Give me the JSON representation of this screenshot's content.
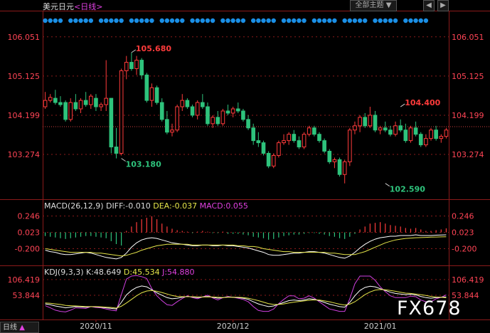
{
  "header": {
    "symbol": "美元日元",
    "period": "<日线>",
    "theme_label": "全部主题",
    "theme_arrow": "▼",
    "prev_arrow": "◀",
    "next_arrow": "▶"
  },
  "indicators": {
    "macd": {
      "name": "MACD(26,12,9)",
      "diff": "DIFF:-0.010",
      "dea": "DEA:-0.037",
      "macd": "MACD:0.055"
    },
    "kdj": {
      "name": "KDJ(9,3,3)",
      "k": "K:48.649",
      "d": "D:45.534",
      "j": "J:54.880"
    }
  },
  "status": {
    "label": "日线",
    "arrow": "▲"
  },
  "watermark": "FX678",
  "colors": {
    "up": "#ff3b3b",
    "down": "#2ec37c",
    "grid": "#8b1a1a",
    "axis_label": "#ff4455",
    "dot": "#1a8fe6",
    "yellow": "#e6e64a",
    "white": "#ffffff",
    "magenta": "#d040e0"
  },
  "chart_data": [
    {
      "type": "candlestick",
      "title": "美元日元 <日线>",
      "y_ticks": [
        "106.051",
        "105.125",
        "104.199",
        "103.274"
      ],
      "y_tick_values": [
        106.051,
        105.125,
        104.199,
        103.274
      ],
      "ylim": [
        102.35,
        106.35
      ],
      "x_ticks": [
        "2020/11",
        "2020/12",
        "2021/01"
      ],
      "x_tick_index": [
        10,
        37,
        66
      ],
      "current_price_line": 103.93,
      "annotations": [
        {
          "text": "105.680",
          "index": 17,
          "value": 105.68,
          "kind": "high"
        },
        {
          "text": "103.180",
          "index": 15,
          "value": 103.18,
          "kind": "low"
        },
        {
          "text": "104.400",
          "index": 70,
          "value": 104.4,
          "kind": "high"
        },
        {
          "text": "102.590",
          "index": 67,
          "value": 102.59,
          "kind": "low"
        }
      ],
      "ohlc": [
        [
          104.4,
          104.75,
          104.35,
          104.55
        ],
        [
          104.55,
          104.7,
          104.5,
          104.62
        ],
        [
          104.6,
          104.8,
          104.45,
          104.5
        ],
        [
          104.5,
          104.65,
          104.4,
          104.45
        ],
        [
          104.5,
          104.55,
          104.05,
          104.1
        ],
        [
          104.1,
          104.6,
          104.05,
          104.5
        ],
        [
          104.5,
          104.7,
          104.3,
          104.35
        ],
        [
          104.35,
          104.6,
          104.25,
          104.55
        ],
        [
          104.55,
          104.75,
          104.4,
          104.45
        ],
        [
          104.45,
          104.7,
          104.35,
          104.65
        ],
        [
          104.6,
          104.7,
          104.3,
          104.4
        ],
        [
          104.4,
          104.5,
          104.3,
          104.45
        ],
        [
          104.45,
          105.5,
          104.3,
          104.6
        ],
        [
          104.6,
          104.6,
          103.3,
          103.45
        ],
        [
          103.45,
          103.9,
          103.18,
          103.3
        ],
        [
          103.3,
          105.3,
          103.25,
          105.25
        ],
        [
          105.25,
          105.6,
          105.05,
          105.45
        ],
        [
          105.45,
          105.68,
          105.25,
          105.3
        ],
        [
          105.3,
          105.6,
          105.15,
          105.5
        ],
        [
          105.5,
          105.55,
          105.05,
          105.15
        ],
        [
          105.15,
          105.2,
          104.5,
          104.55
        ],
        [
          104.55,
          104.95,
          104.4,
          104.85
        ],
        [
          104.85,
          104.9,
          104.45,
          104.5
        ],
        [
          104.5,
          104.6,
          104.05,
          104.1
        ],
        [
          104.1,
          104.3,
          103.75,
          103.8
        ],
        [
          103.8,
          104.0,
          103.7,
          103.85
        ],
        [
          103.85,
          104.45,
          103.8,
          104.4
        ],
        [
          104.4,
          104.7,
          104.3,
          104.55
        ],
        [
          104.55,
          104.6,
          104.35,
          104.4
        ],
        [
          104.4,
          104.45,
          104.15,
          104.2
        ],
        [
          104.2,
          104.55,
          104.1,
          104.5
        ],
        [
          104.5,
          104.7,
          104.35,
          104.4
        ],
        [
          104.4,
          104.5,
          103.95,
          104.0
        ],
        [
          104.0,
          104.2,
          103.9,
          104.15
        ],
        [
          104.15,
          104.3,
          103.95,
          104.0
        ],
        [
          104.0,
          104.35,
          103.95,
          104.3
        ],
        [
          104.3,
          104.45,
          104.2,
          104.25
        ],
        [
          104.25,
          104.4,
          104.15,
          104.35
        ],
        [
          104.35,
          104.5,
          104.25,
          104.3
        ],
        [
          104.3,
          104.35,
          104.05,
          104.1
        ],
        [
          104.1,
          104.2,
          103.85,
          103.9
        ],
        [
          103.9,
          104.0,
          103.5,
          103.6
        ],
        [
          103.6,
          103.8,
          103.45,
          103.55
        ],
        [
          103.55,
          103.6,
          103.25,
          103.3
        ],
        [
          103.3,
          103.35,
          102.95,
          103.0
        ],
        [
          103.0,
          103.3,
          102.95,
          103.25
        ],
        [
          103.25,
          103.6,
          103.2,
          103.55
        ],
        [
          103.55,
          103.75,
          103.5,
          103.6
        ],
        [
          103.6,
          103.8,
          103.5,
          103.75
        ],
        [
          103.75,
          103.85,
          103.55,
          103.6
        ],
        [
          103.6,
          103.7,
          103.4,
          103.45
        ],
        [
          103.45,
          103.8,
          103.4,
          103.75
        ],
        [
          103.75,
          103.95,
          103.7,
          103.9
        ],
        [
          103.9,
          103.95,
          103.7,
          103.75
        ],
        [
          103.75,
          103.8,
          103.55,
          103.6
        ],
        [
          103.6,
          103.65,
          103.3,
          103.35
        ],
        [
          103.35,
          103.4,
          103.05,
          103.1
        ],
        [
          103.1,
          103.2,
          102.95,
          103.15
        ],
        [
          103.15,
          103.2,
          102.75,
          102.8
        ],
        [
          102.8,
          103.15,
          102.59,
          103.1
        ],
        [
          103.1,
          103.9,
          103.0,
          103.85
        ],
        [
          103.85,
          104.05,
          103.75,
          103.95
        ],
        [
          103.95,
          104.2,
          103.8,
          104.15
        ],
        [
          104.15,
          104.25,
          103.9,
          103.95
        ],
        [
          103.95,
          104.4,
          103.9,
          104.2
        ],
        [
          104.2,
          104.3,
          103.8,
          103.85
        ],
        [
          103.85,
          103.95,
          103.75,
          103.9
        ],
        [
          103.9,
          104.05,
          103.8,
          103.85
        ],
        [
          103.85,
          103.95,
          103.7,
          103.75
        ],
        [
          103.75,
          104.05,
          103.7,
          103.95
        ],
        [
          103.95,
          104.1,
          103.8,
          103.85
        ],
        [
          103.85,
          104.0,
          103.55,
          103.6
        ],
        [
          103.6,
          103.95,
          103.55,
          103.9
        ],
        [
          103.9,
          104.05,
          103.7,
          103.75
        ],
        [
          103.75,
          103.8,
          103.45,
          103.5
        ],
        [
          103.5,
          103.75,
          103.45,
          103.65
        ],
        [
          103.65,
          103.9,
          103.6,
          103.85
        ],
        [
          103.85,
          103.95,
          103.6,
          103.65
        ],
        [
          103.65,
          103.75,
          103.55,
          103.7
        ],
        [
          103.7,
          103.9,
          103.65,
          103.85
        ]
      ]
    },
    {
      "type": "macd",
      "title": "MACD(26,12,9)",
      "y_ticks": [
        "0.246",
        "0.023",
        "-0.200"
      ],
      "y_tick_values": [
        0.246,
        0.023,
        -0.2
      ],
      "ylim": [
        -0.38,
        0.34
      ],
      "histogram": [
        -0.05,
        -0.06,
        -0.07,
        -0.08,
        -0.09,
        -0.08,
        -0.07,
        -0.06,
        -0.05,
        -0.05,
        -0.06,
        -0.07,
        -0.08,
        -0.12,
        -0.16,
        -0.18,
        0.02,
        0.08,
        0.14,
        0.18,
        0.2,
        0.22,
        0.18,
        0.12,
        0.08,
        0.05,
        0.03,
        0.02,
        0.01,
        -0.01,
        0.01,
        0.02,
        0.01,
        -0.01,
        -0.01,
        0.01,
        -0.02,
        -0.02,
        -0.02,
        -0.03,
        -0.04,
        -0.06,
        -0.07,
        -0.08,
        -0.1,
        -0.09,
        -0.07,
        -0.05,
        -0.04,
        -0.03,
        -0.03,
        -0.02,
        -0.01,
        -0.01,
        -0.02,
        -0.03,
        -0.05,
        -0.06,
        -0.08,
        -0.09,
        -0.06,
        -0.02,
        0.04,
        0.08,
        0.12,
        0.13,
        0.14,
        0.12,
        0.1,
        0.09,
        0.08,
        0.06,
        0.05,
        0.06,
        0.04,
        0.02,
        0.02,
        0.03,
        0.04,
        0.055
      ],
      "diff": [
        -0.22,
        -0.24,
        -0.25,
        -0.27,
        -0.28,
        -0.28,
        -0.27,
        -0.26,
        -0.25,
        -0.26,
        -0.28,
        -0.3,
        -0.32,
        -0.33,
        -0.34,
        -0.32,
        -0.26,
        -0.18,
        -0.12,
        -0.08,
        -0.06,
        -0.05,
        -0.06,
        -0.08,
        -0.1,
        -0.12,
        -0.13,
        -0.14,
        -0.15,
        -0.16,
        -0.16,
        -0.15,
        -0.15,
        -0.16,
        -0.16,
        -0.15,
        -0.16,
        -0.16,
        -0.17,
        -0.18,
        -0.19,
        -0.21,
        -0.23,
        -0.25,
        -0.28,
        -0.29,
        -0.29,
        -0.28,
        -0.27,
        -0.26,
        -0.26,
        -0.25,
        -0.24,
        -0.24,
        -0.25,
        -0.26,
        -0.28,
        -0.3,
        -0.32,
        -0.33,
        -0.3,
        -0.25,
        -0.19,
        -0.14,
        -0.1,
        -0.07,
        -0.05,
        -0.04,
        -0.03,
        -0.03,
        -0.02,
        -0.02,
        -0.02,
        -0.01,
        -0.02,
        -0.02,
        -0.02,
        -0.015,
        -0.012,
        -0.01
      ],
      "dea": [
        -0.2,
        -0.21,
        -0.22,
        -0.23,
        -0.24,
        -0.25,
        -0.25,
        -0.25,
        -0.25,
        -0.25,
        -0.26,
        -0.26,
        -0.27,
        -0.28,
        -0.29,
        -0.3,
        -0.29,
        -0.27,
        -0.25,
        -0.22,
        -0.2,
        -0.18,
        -0.16,
        -0.15,
        -0.14,
        -0.14,
        -0.14,
        -0.14,
        -0.14,
        -0.15,
        -0.15,
        -0.15,
        -0.15,
        -0.15,
        -0.15,
        -0.15,
        -0.15,
        -0.15,
        -0.16,
        -0.16,
        -0.17,
        -0.17,
        -0.18,
        -0.2,
        -0.21,
        -0.22,
        -0.23,
        -0.24,
        -0.24,
        -0.25,
        -0.25,
        -0.25,
        -0.25,
        -0.25,
        -0.25,
        -0.25,
        -0.26,
        -0.26,
        -0.27,
        -0.28,
        -0.28,
        -0.28,
        -0.26,
        -0.24,
        -0.21,
        -0.18,
        -0.15,
        -0.12,
        -0.1,
        -0.08,
        -0.07,
        -0.06,
        -0.055,
        -0.05,
        -0.048,
        -0.045,
        -0.042,
        -0.04,
        -0.038,
        -0.037
      ]
    },
    {
      "type": "kdj",
      "title": "KDJ(9,3,3)",
      "y_ticks": [
        "106.419",
        "53.844"
      ],
      "y_tick_values": [
        106.419,
        53.844
      ],
      "ylim": [
        -20,
        118
      ],
      "k": [
        25,
        22,
        18,
        15,
        12,
        14,
        16,
        15,
        14,
        16,
        15,
        14,
        12,
        10,
        8,
        30,
        55,
        70,
        80,
        85,
        82,
        72,
        62,
        54,
        46,
        42,
        44,
        47,
        50,
        48,
        46,
        48,
        50,
        47,
        44,
        46,
        48,
        47,
        46,
        44,
        40,
        32,
        25,
        20,
        16,
        18,
        24,
        30,
        36,
        38,
        36,
        38,
        42,
        40,
        36,
        30,
        24,
        20,
        16,
        14,
        30,
        52,
        70,
        80,
        84,
        82,
        76,
        70,
        64,
        60,
        58,
        56,
        57,
        55,
        50,
        46,
        44,
        46,
        47,
        48.6
      ],
      "d": [
        28,
        27,
        25,
        23,
        20,
        19,
        18,
        17,
        16,
        16,
        16,
        15,
        14,
        13,
        11,
        17,
        28,
        40,
        52,
        62,
        68,
        70,
        67,
        63,
        58,
        53,
        50,
        49,
        49,
        49,
        48,
        48,
        48,
        48,
        47,
        46,
        47,
        47,
        47,
        46,
        44,
        40,
        36,
        31,
        26,
        23,
        23,
        25,
        28,
        31,
        33,
        35,
        37,
        38,
        38,
        35,
        32,
        28,
        24,
        21,
        24,
        32,
        44,
        56,
        65,
        71,
        73,
        72,
        70,
        67,
        64,
        61,
        60,
        58,
        56,
        53,
        50,
        48,
        47,
        45.5
      ],
      "j": [
        19,
        12,
        4,
        0,
        -2,
        4,
        12,
        11,
        10,
        16,
        13,
        12,
        8,
        4,
        2,
        56,
        108,
        118,
        120,
        116,
        110,
        76,
        52,
        36,
        22,
        20,
        32,
        43,
        52,
        46,
        42,
        48,
        54,
        45,
        38,
        46,
        50,
        47,
        44,
        40,
        32,
        16,
        3,
        0,
        0,
        8,
        26,
        40,
        52,
        52,
        42,
        44,
        52,
        44,
        32,
        20,
        8,
        4,
        0,
        0,
        42,
        92,
        118,
        118,
        118,
        104,
        82,
        66,
        52,
        46,
        46,
        46,
        51,
        49,
        38,
        32,
        32,
        42,
        47,
        54.9
      ]
    }
  ]
}
